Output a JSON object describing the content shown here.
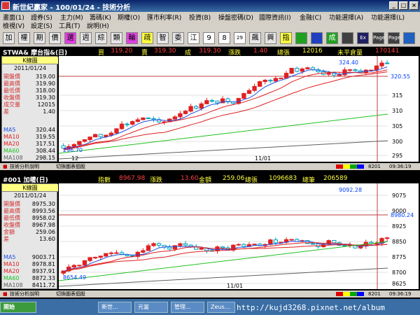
{
  "window": {
    "title": "新世紀贏家 - 100/01/24 - 技術分析"
  },
  "menu": [
    "畫面(1)",
    "證券(S)",
    "主力(M)",
    "籌碼(K)",
    "期權(O)",
    "匯市利率(R)",
    "投資(B)",
    "操盤密碼(D)",
    "國際資訊(I)",
    "金融(C)",
    "功能選擇(A)",
    "功能選擇(L)",
    "檢視(V)",
    "設定(S)",
    "工具(T)",
    "說明(H)"
  ],
  "toolbar": [
    "加",
    "權",
    "期",
    "價",
    "選",
    "週",
    "綜",
    "類",
    "輪",
    "疏",
    "智",
    "委",
    "江",
    "9",
    "8",
    "29",
    "飆",
    "興",
    "指",
    "",
    "",
    "成",
    "",
    "Ex",
    "Page",
    "Page",
    ""
  ],
  "panel1": {
    "symbol": "STWA& 摩台指&(日)",
    "bid_label": "買",
    "bid": "319.20",
    "ask_label": "賣",
    "ask": "319.30",
    "last_label": "成",
    "last": "319.30",
    "chg_label": "漲跌",
    "chg": "1.40",
    "vol_label": "總張",
    "vol": "12016",
    "oi_label": "未平倉量",
    "oi": "170141",
    "kline_btn": "K線圖",
    "date": "2011/01/24",
    "quote": [
      {
        "label": "開盤價",
        "value": "319.00"
      },
      {
        "label": "最高價",
        "value": "319.90"
      },
      {
        "label": "最低價",
        "value": "318.00"
      },
      {
        "label": "收盤價",
        "value": "319.30"
      },
      {
        "label": "成交量",
        "value": "12015"
      },
      {
        "label": "差",
        "value": "1.40"
      }
    ],
    "ma": [
      {
        "label": "MA5",
        "value": "320.44",
        "color": "#2050e0"
      },
      {
        "label": "MA10",
        "value": "319.55",
        "color": "#e02020"
      },
      {
        "label": "MA20",
        "value": "317.51",
        "color": "#e02020"
      },
      {
        "label": "MA60",
        "value": "308.44",
        "color": "#20c020"
      },
      {
        "label": "MA108",
        "value": "298.15",
        "color": "#606060"
      }
    ],
    "high_label": "324.40",
    "low_label": "296.70",
    "last_price_tag": "320.55",
    "yaxis": [
      "315",
      "310",
      "305",
      "300",
      "295"
    ],
    "x_labels": [
      "12",
      "11/01"
    ],
    "status_left": "技術分析說明",
    "status_mid": "切換圖表個股",
    "status_code": "8201",
    "status_time": "09:36:19"
  },
  "panel2": {
    "symbol": "#001 加權(日)",
    "idx_label": "指數",
    "idx": "8967.98",
    "chg_label": "漲跌",
    "chg": "13.60",
    "amt_label": "金額",
    "amt": "259.06",
    "vol_label": "總張",
    "vol": "1096683",
    "cnt_label": "總筆",
    "cnt": "206589",
    "kline_btn": "K線圖",
    "date": "2011/01/24",
    "quote": [
      {
        "label": "開盤價",
        "value": "8975.30"
      },
      {
        "label": "最高價",
        "value": "8993.56"
      },
      {
        "label": "最低價",
        "value": "8958.02"
      },
      {
        "label": "收盤價",
        "value": "8967.98"
      },
      {
        "label": "金額",
        "value": "259.06"
      },
      {
        "label": "差",
        "value": "13.60"
      }
    ],
    "ma": [
      {
        "label": "MA5",
        "value": "9003.71",
        "color": "#2050e0"
      },
      {
        "label": "MA10",
        "value": "8978.81",
        "color": "#e02020"
      },
      {
        "label": "MA20",
        "value": "8937.91",
        "color": "#e02020"
      },
      {
        "label": "MA60",
        "value": "8872.33",
        "color": "#20c020"
      },
      {
        "label": "MA108",
        "value": "8411.72",
        "color": "#606060"
      }
    ],
    "high_label": "9092.28",
    "low_label": "8654.49",
    "last_price_tag": "8980.24",
    "yaxis": [
      "9075",
      "9000",
      "8925",
      "8850",
      "8775",
      "8700",
      "8625"
    ],
    "x_labels": [
      "11/01"
    ],
    "status_left": "技術分析說明",
    "status_mid": "切換圖表個股",
    "status_code": "8201",
    "status_time": "09:36:19"
  },
  "taskbar": {
    "start": "開始",
    "items": [
      "新世...",
      "元富",
      "管理...",
      "Zeus...",
      "http://kujd3268.pixnet.net/album"
    ]
  },
  "watermark": "http://kujd3268.pixnet.net/album"
}
